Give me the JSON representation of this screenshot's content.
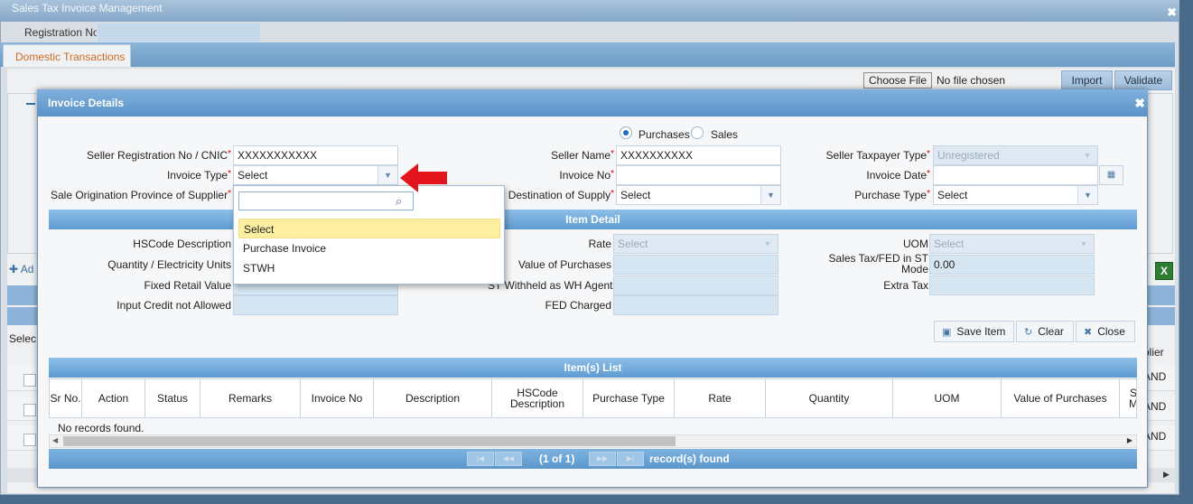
{
  "background": {
    "window_title": "Sales Tax Invoice Management",
    "close": "✖",
    "registration_label": "Registration No",
    "tab_domestic": "Domestic Transactions",
    "choose_file": "Choose File",
    "no_file": "No file chosen",
    "import": "Import",
    "validate": "Validate",
    "add_label": "Ad",
    "select_label": "Selec",
    "right_texts": [
      "plier",
      "AND",
      "AND",
      "AND"
    ]
  },
  "dialog": {
    "title": "Invoice Details",
    "close": "✖",
    "radio_purchases": "Purchases",
    "radio_sales": "Sales",
    "seller_reg_label": "Seller Registration No / CNIC",
    "seller_reg_value": "XXXXXXXXXXX",
    "invoice_type_label": "Invoice Type",
    "invoice_type_value": "Select",
    "province_label": "Sale Origination Province of Supplier",
    "seller_name_label": "Seller Name",
    "seller_name_value": "XXXXXXXXXX",
    "invoice_no_label": "Invoice No",
    "invoice_no_value": "",
    "destination_label": "Destination of Supply",
    "destination_value": "Select",
    "taxpayer_type_label": "Seller Taxpayer Type",
    "taxpayer_type_value": "Unregistered",
    "invoice_date_label": "Invoice Date",
    "invoice_date_value": "",
    "purchase_type_label": "Purchase Type",
    "purchase_type_value": "Select",
    "item_detail_title": "Item Detail",
    "hscode_label": "HSCode Description",
    "qty_label": "Quantity / Electricity Units",
    "fixed_retail_label": "Fixed Retail Value",
    "input_credit_label": "Input Credit not Allowed",
    "rate_label": "Rate",
    "rate_value": "Select",
    "value_purchases_label": "Value of Purchases",
    "st_withheld_label": "ST Withheld as WH Agent",
    "fed_charged_label": "FED Charged",
    "uom_label": "UOM",
    "uom_value": "Select",
    "sales_tax_label_1": "Sales Tax/FED in ST",
    "sales_tax_label_2": "Mode",
    "sales_tax_value": "0.00",
    "extra_tax_label": "Extra Tax",
    "save_item": "Save Item",
    "clear": "Clear",
    "close_btn": "Close",
    "items_list_title": "Item(s) List",
    "columns": [
      "Sr No.",
      "Action",
      "Status",
      "Remarks",
      "Invoice No",
      "Description",
      "HSCode Description",
      "Purchase Type",
      "Rate",
      "Quantity",
      "UOM",
      "Value of Purchases",
      "S M"
    ],
    "no_records": "No records found.",
    "pager_status": "(1 of 1)",
    "records_found": "record(s) found"
  },
  "dropdown": {
    "search_value": "",
    "options": [
      "Select",
      "Purchase Invoice",
      "STWH"
    ],
    "highlighted": "Select"
  },
  "colors": {
    "accent": "#5b93c8",
    "highlight": "#fcefa1",
    "required": "#d40000",
    "arrow": "#e3141b",
    "tab_active_text": "#d26a1f"
  }
}
